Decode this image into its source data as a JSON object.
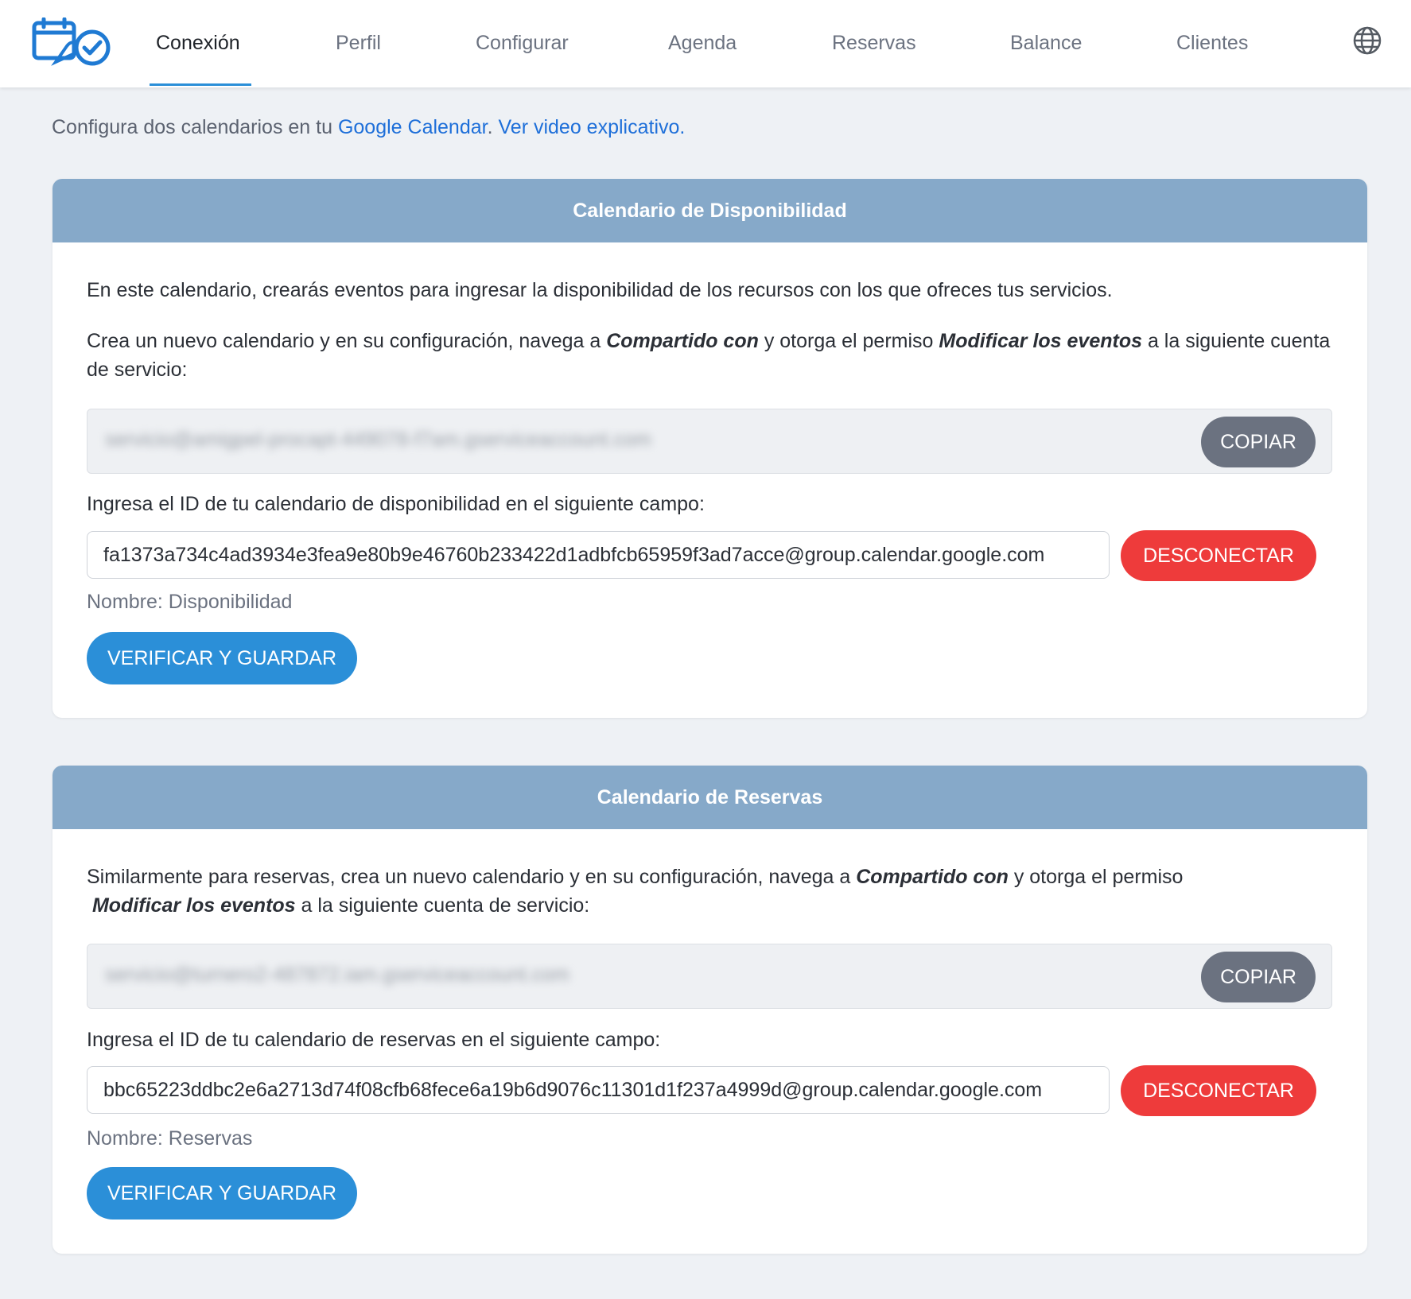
{
  "nav": {
    "tabs": [
      {
        "label": "Conexión",
        "active": true
      },
      {
        "label": "Perfil",
        "active": false
      },
      {
        "label": "Configurar",
        "active": false
      },
      {
        "label": "Agenda",
        "active": false
      },
      {
        "label": "Reservas",
        "active": false
      },
      {
        "label": "Balance",
        "active": false
      },
      {
        "label": "Clientes",
        "active": false
      }
    ],
    "logo_icon": "calendar-check-icon",
    "language_icon": "globe-icon"
  },
  "intro": {
    "text": "Configura dos calendarios en tu ",
    "link_calendar": "Google Calendar",
    "separator": ". ",
    "link_video": "Ver video explicativo."
  },
  "availability": {
    "header": "Calendario de Disponibilidad",
    "p1": "En este calendario, crearás eventos para ingresar la disponibilidad de los recursos con los que ofreces tus servicios.",
    "p2_a": "Crea un nuevo calendario y en su configuración, navega a ",
    "p2_em1": "Compartido con",
    "p2_b": " y otorga el permiso ",
    "p2_em2": "Modificar los eventos",
    "p2_c": " a la siguiente cuenta de servicio:",
    "service_account": "servicio@amigpel-procapt-449078-f7am.gserviceaccount.com",
    "copy_label": "COPIAR",
    "id_prompt": "Ingresa el ID de tu calendario de disponibilidad en el siguiente campo:",
    "calendar_id": "fa1373a734c4ad3934e3fea9e80b9e46760b233422d1adbfcb65959f3ad7acce@group.calendar.google.com",
    "disconnect_label": "DESCONECTAR",
    "name_line": "Nombre: Disponibilidad",
    "verify_label": "VERIFICAR Y GUARDAR"
  },
  "reservations": {
    "header": "Calendario de Reservas",
    "p1_a": "Similarmente para reservas, crea un nuevo calendario y en su configuración, navega a ",
    "p1_em1": "Compartido con",
    "p1_b": " y otorga el permiso",
    "p1_em2": "Modificar los eventos",
    "p1_c": " a la siguiente cuenta de servicio:",
    "service_account": "servicio@turnero2-487872.iam.gserviceaccount.com",
    "copy_label": "COPIAR",
    "id_prompt": "Ingresa el ID de tu calendario de reservas en el siguiente campo:",
    "calendar_id": "bbc65223ddbc2e6a2713d74f08cfb68fece6a19b6d9076c11301d1f237a4999d@group.calendar.google.com",
    "disconnect_label": "DESCONECTAR",
    "name_line": "Nombre: Reservas",
    "verify_label": "VERIFICAR Y GUARDAR"
  }
}
